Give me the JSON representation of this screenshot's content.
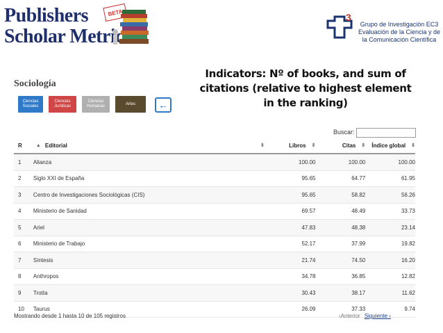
{
  "brand": {
    "line1": "Publishers",
    "line2": "Scholar Metrics",
    "badge": "BETA"
  },
  "ec3": {
    "logo_text": "3",
    "text": "Grupo de Investigación EC3 Evaluación de la Ciencia y de la Comunicación Científica"
  },
  "headline": "Indicators: Nº of books, and sum of citations (relative to highest element in the ranking)",
  "section_title": "Sociología",
  "categories": [
    {
      "label": "Ciencias Sociales",
      "color": "#2f7ac8"
    },
    {
      "label": "Ciencias Jurídicas",
      "color": "#d04545"
    },
    {
      "label": "Ciencias Humanas",
      "color": "#b0b0b0"
    },
    {
      "label": "Artes",
      "color": "#5a4a2e"
    }
  ],
  "back_icon": "arrow-left-icon",
  "search": {
    "label": "Buscar:",
    "value": ""
  },
  "table": {
    "headers": {
      "rank": "R",
      "editorial": "Editorial",
      "libros": "Libros",
      "citas": "Citas",
      "indice": "Índice global"
    },
    "rows": [
      {
        "rank": "1",
        "editorial": "Alianza",
        "libros": "100.00",
        "citas": "100.00",
        "indice": "100.00"
      },
      {
        "rank": "2",
        "editorial": "Siglo XXI de España",
        "libros": "95.65",
        "citas": "64.77",
        "indice": "61.95"
      },
      {
        "rank": "3",
        "editorial": "Centro de Investigaciones Sociológicas (CIS)",
        "libros": "95.65",
        "citas": "58.82",
        "indice": "56.26"
      },
      {
        "rank": "4",
        "editorial": "Ministerio de Sanidad",
        "libros": "69.57",
        "citas": "48.49",
        "indice": "33.73"
      },
      {
        "rank": "5",
        "editorial": "Ariel",
        "libros": "47.83",
        "citas": "48.38",
        "indice": "23.14"
      },
      {
        "rank": "6",
        "editorial": "Ministerio de Trabajo",
        "libros": "52.17",
        "citas": "37.99",
        "indice": "19.82"
      },
      {
        "rank": "7",
        "editorial": "Síntesis",
        "libros": "21.74",
        "citas": "74.50",
        "indice": "16.20"
      },
      {
        "rank": "8",
        "editorial": "Anthropos",
        "libros": "34.78",
        "citas": "36.85",
        "indice": "12.82"
      },
      {
        "rank": "9",
        "editorial": "Trotta",
        "libros": "30.43",
        "citas": "38.17",
        "indice": "11.62"
      },
      {
        "rank": "10",
        "editorial": "Taurus",
        "libros": "26.09",
        "citas": "37.33",
        "indice": "9.74"
      }
    ]
  },
  "footer": {
    "info": "Mostrando desde 1 hasta 10 de 105 registros",
    "prev": "Anterior",
    "next": "Siguiente"
  }
}
